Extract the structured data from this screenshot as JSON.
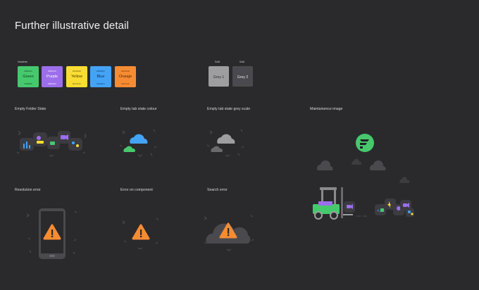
{
  "title": "Further illustrative detail",
  "swatch_group_label": "Gradients",
  "swatches": [
    {
      "top": "#6BE38A",
      "name": "Green",
      "bottom": "#36B85F",
      "color": "#46C96D",
      "text": "#0f3b1b"
    },
    {
      "top": "#B08CF0",
      "name": "Purple",
      "bottom": "#8B5FE0",
      "color": "#9C6EEB",
      "text": "#ffffff"
    },
    {
      "top": "#FFE94D",
      "name": "Yellow",
      "bottom": "#F2CF1C",
      "color": "#FADD33",
      "text": "#4a3d00"
    },
    {
      "top": "#5DB8FF",
      "name": "Blue",
      "bottom": "#2F8EF0",
      "color": "#43A3F7",
      "text": "#0b2f55"
    },
    {
      "top": "#FFA34D",
      "name": "Orange",
      "bottom": "#F07A1F",
      "color": "#F58C33",
      "text": "#5a2600"
    }
  ],
  "greys": [
    {
      "label": "Solid",
      "name": "Grey 1",
      "color": "#9E9EA0",
      "text": "#2a2a2c"
    },
    {
      "label": "Solid",
      "name": "Grey 2",
      "color": "#4A4A4E",
      "text": "#e8e8e8"
    }
  ],
  "sections": {
    "empty_folder": "Empty Folder State",
    "empty_tab_colour": "Empty tab state colour",
    "empty_tab_grey": "Empty tab state grey scale",
    "maintenance": "Maintainence image",
    "resolution_error": "Resolution error",
    "error_component": "Error on component",
    "search_error": "Search error"
  }
}
